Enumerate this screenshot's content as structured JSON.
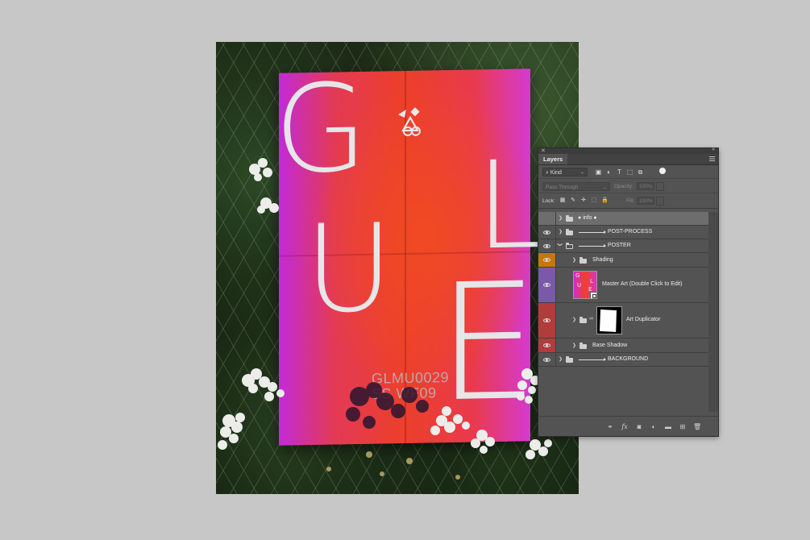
{
  "poster": {
    "letters": [
      "G",
      "L",
      "U",
      "E"
    ],
    "code_line1": "GLMU0029",
    "code_line2": "SS WF09"
  },
  "layers_panel": {
    "title": "Layers",
    "filter": {
      "kind_label": "Kind"
    },
    "blend_mode": "Pass Through",
    "opacity_label": "Opacity:",
    "opacity_value": "100%",
    "lock_label": "Lock:",
    "fill_label": "Fill:",
    "fill_value": "100%",
    "layers": [
      {
        "name": "info",
        "type": "group",
        "visible": false,
        "selected": true,
        "color": "none"
      },
      {
        "name": "POST-PROCESS",
        "type": "group",
        "visible": true,
        "color": "none"
      },
      {
        "name": "POSTER",
        "type": "group-open",
        "visible": true,
        "color": "none"
      },
      {
        "name": "Shading",
        "type": "group",
        "visible": true,
        "color": "#c5770e"
      },
      {
        "name": "Master Art (Double Click to Edit)",
        "type": "smart-object",
        "visible": true,
        "color": "#7a5aa8"
      },
      {
        "name": "Art Duplicator",
        "type": "group-masked",
        "visible": true,
        "color": "#b23b3b"
      },
      {
        "name": "Base Shadow",
        "type": "group",
        "visible": true,
        "color": "#b23b3b"
      },
      {
        "name": "BACKGROUND",
        "type": "group",
        "visible": true,
        "color": "none"
      }
    ]
  }
}
